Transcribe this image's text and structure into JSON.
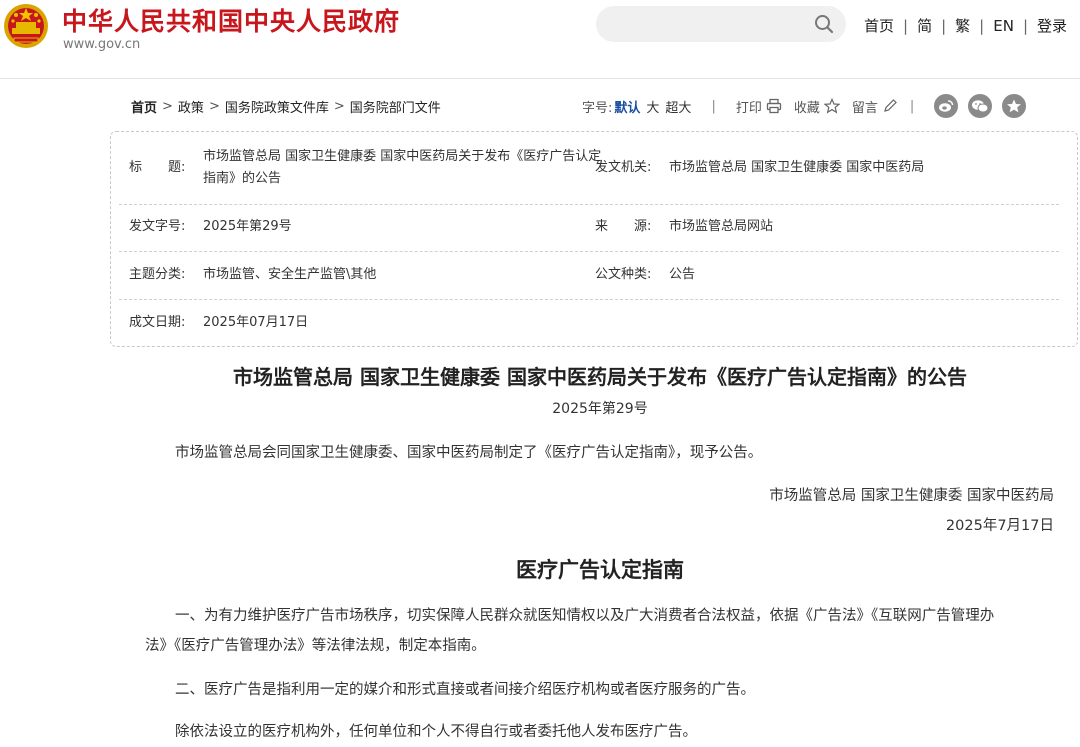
{
  "header": {
    "site_title": "中华人民共和国中央人民政府",
    "site_url": "www.gov.cn",
    "search_placeholder": "",
    "nav": [
      "首页",
      "简",
      "繁",
      "EN",
      "登录"
    ],
    "brand_color": "#c8161d"
  },
  "breadcrumb": [
    "首页",
    "政策",
    "国务院政策文件库",
    "国务院部门文件"
  ],
  "breadcrumb_sep": ">",
  "tools": {
    "font_label": "字号:",
    "font_default": "默认",
    "font_large": "大",
    "font_xlarge": "超大",
    "separator": "|",
    "print": "打印",
    "favorite": "收藏",
    "comment": "留言",
    "share_icons": [
      "weibo-icon",
      "wechat-icon",
      "star-share-icon"
    ]
  },
  "meta": {
    "title_label": "标　　题:",
    "title_value": "市场监管总局 国家卫生健康委 国家中医药局关于发布《医疗广告认定指南》的公告",
    "issuer_label": "发文机关:",
    "issuer_value": "市场监管总局 国家卫生健康委 国家中医药局",
    "docno_label": "发文字号:",
    "docno_value": "2025年第29号",
    "source_label": "来　　源:",
    "source_value": "市场监管总局网站",
    "topic_label": "主题分类:",
    "topic_value": "市场监管、安全生产监管\\其他",
    "type_label": "公文种类:",
    "type_value": "公告",
    "date_label": "成文日期:",
    "date_value": "2025年07月17日"
  },
  "article": {
    "title": "市场监管总局 国家卫生健康委 国家中医药局关于发布《医疗广告认定指南》的公告",
    "doc_no": "2025年第29号",
    "intro": "市场监管总局会同国家卫生健康委、国家中医药局制定了《医疗广告认定指南》，现予公告。",
    "signers": "市场监管总局 国家卫生健康委 国家中医药局",
    "sign_date": "2025年7月17日",
    "subtitle": "医疗广告认定指南",
    "p1_line1": "一、为有力维护医疗广告市场秩序，切实保障人民群众就医知情权以及广大消费者合法权益，依据《广告法》《互联网广告管理办",
    "p1_line2": "法》《医疗广告管理办法》等法律法规，制定本指南。",
    "p2": "二、医疗广告是指利用一定的媒介和形式直接或者间接介绍医疗机构或者医疗服务的广告。",
    "p3": "除依法设立的医疗机构外，任何单位和个人不得自行或者委托他人发布医疗广告。"
  }
}
